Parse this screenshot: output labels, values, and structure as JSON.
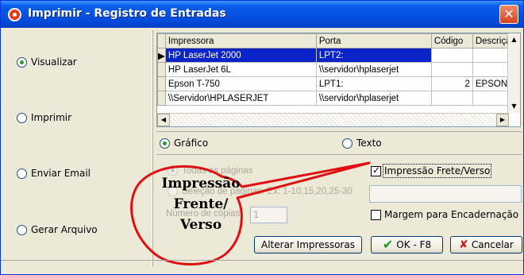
{
  "window": {
    "title": "Imprimir - Registro de Entradas",
    "close_glyph": "✕"
  },
  "output_options": [
    {
      "label": "Visualizar",
      "selected": true
    },
    {
      "label": "Imprimir",
      "selected": false
    },
    {
      "label": "Enviar Email",
      "selected": false
    },
    {
      "label": "Gerar Arquivo",
      "selected": false
    }
  ],
  "printers": {
    "columns": [
      "Impressora",
      "Porta",
      "Código",
      "Descriçã"
    ],
    "rows": [
      {
        "name": "HP LaserJet 2000",
        "port": "LPT2:",
        "code": "",
        "desc": "",
        "selected": true
      },
      {
        "name": "HP LaserJet 6L",
        "port": "\\\\servidor\\hplaserjet",
        "code": "",
        "desc": ""
      },
      {
        "name": "Epson T-750",
        "port": "LPT1:",
        "code": "2",
        "desc": "EPSON F"
      },
      {
        "name": "\\\\Servidor\\HPLASERJET",
        "port": "\\\\servidor\\hplaserjet",
        "code": "",
        "desc": ""
      }
    ],
    "selected_index": 0
  },
  "mode": {
    "grafico": "Gráfico",
    "texto": "Texto",
    "selected": "grafico"
  },
  "pages": {
    "all_label": "Todas as páginas",
    "selection_label": "Seleção de páginas. Ex: 1-10,15,20,25-30",
    "copies_label": "Número de cópias",
    "copies_value": "1",
    "selection_value": ""
  },
  "options": {
    "duplex_label": "Impressão Frete/Verso",
    "duplex_checked": true,
    "binding_label": "Margem para Encadernação",
    "binding_checked": false
  },
  "buttons": {
    "change_printers": "Alterar Impressoras",
    "ok": "OK - F8",
    "cancel": "Cancelar"
  },
  "annotation": {
    "line1": "Impressão",
    "line2": "Frente/",
    "line3": "Verso",
    "color": "#e01010"
  }
}
